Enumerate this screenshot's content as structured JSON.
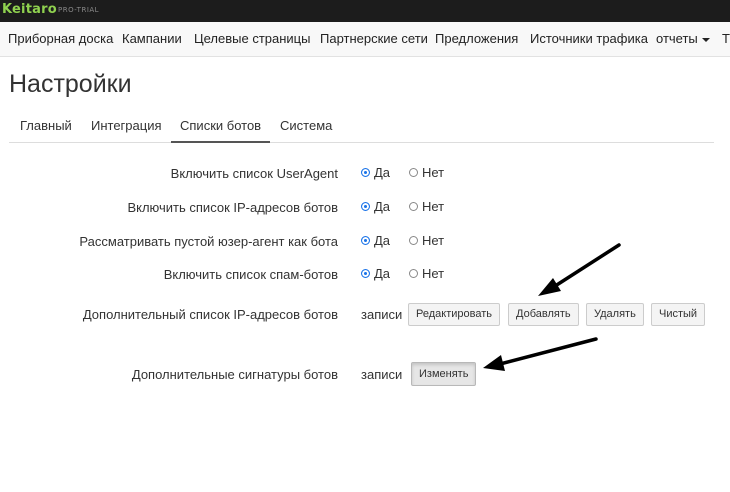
{
  "app": {
    "logo": "Keitaro",
    "badge": "PRO-TRIAL"
  },
  "nav": {
    "items": [
      "Приборная доска",
      "Кампании",
      "Целевые страницы",
      "Партнерские сети",
      "Предложения",
      "Источники трафика",
      "отчеты",
      "Т"
    ]
  },
  "page": {
    "title": "Настройки"
  },
  "tabs": [
    {
      "label": "Главный",
      "active": false
    },
    {
      "label": "Интеграция",
      "active": false
    },
    {
      "label": "Списки ботов",
      "active": true
    },
    {
      "label": "Система",
      "active": false
    }
  ],
  "settings": {
    "rows": [
      {
        "label": "Включить список UserAgent",
        "yes": "Да",
        "no": "Нет",
        "value": "Да"
      },
      {
        "label": "Включить список IP-адресов ботов",
        "yes": "Да",
        "no": "Нет",
        "value": "Да"
      },
      {
        "label": "Рассматривать пустой юзер-агент как бота",
        "yes": "Да",
        "no": "Нет",
        "value": "Да"
      },
      {
        "label": "Включить список спам-ботов",
        "yes": "Да",
        "no": "Нет",
        "value": "Да"
      }
    ],
    "ip_list": {
      "label": "Дополнительный список IP-адресов ботов",
      "records": "записи",
      "buttons": {
        "edit": "Редактировать",
        "add": "Добавлять",
        "delete": "Удалять",
        "clear": "Чистый"
      }
    },
    "signatures": {
      "label": "Дополнительные сигнатуры ботов",
      "records": "записи",
      "buttons": {
        "change": "Изменять"
      }
    }
  },
  "colors": {
    "topbar": "#1c1c1c",
    "logo": "#8fd14f",
    "radio_checked": "#1a73e8",
    "arrow": "#000000"
  }
}
